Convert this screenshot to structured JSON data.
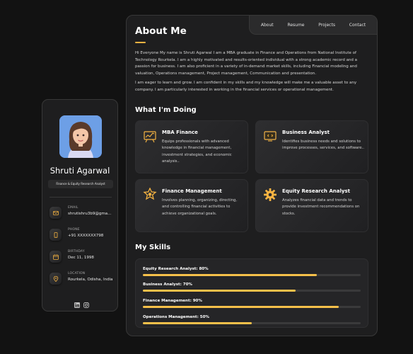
{
  "theme": {
    "accent": "#f5b342",
    "background": "#121212",
    "card": "#1e1e1f"
  },
  "profile": {
    "name": "Shruti Agarwal",
    "title": "Finance & Equity Research Analyst",
    "contacts": [
      {
        "label": "EMAIL",
        "value": "shrutishru3b9@gma...",
        "icon": "mail-icon"
      },
      {
        "label": "PHONE",
        "value": "+91 XXXXXXX798",
        "icon": "phone-icon"
      },
      {
        "label": "BIRTHDAY",
        "value": "Dec 11, 1998",
        "icon": "calendar-icon"
      },
      {
        "label": "LOCATION",
        "value": "Rourkela, Odisha, India",
        "icon": "location-pin-icon"
      }
    ],
    "social": [
      "linkedin-icon",
      "instagram-icon"
    ]
  },
  "nav": {
    "about": "About",
    "resume": "Resume",
    "projects": "Projects",
    "contact": "Contact"
  },
  "about": {
    "heading": "About Me",
    "p1": "Hi Everyone My name is Shruti Agarwal I am a MBA graduate in Finance and Operations from National Institute of Technology Rourkela. I am a highly motivated and results-oriented individual with a strong academic record and a passion for business. I am also proficient in a variety of in-demand market skills, including Financial modeling and valuation, Operations management, Project management, Communication and presentation.",
    "p2": "I am eager to learn and grow. I am confident in my skills and my knowledge will make me a valuable asset to any company. I am particularly interested in working in the financial services or operational management."
  },
  "doing": {
    "heading": "What I'm Doing",
    "services": [
      {
        "title": "MBA Finance",
        "desc": "Equips professionals with advanced knowledge in financial management, investment strategies, and economic analysis..",
        "icon": "chart-board-icon"
      },
      {
        "title": "Business Analyst",
        "desc": "Identifies business needs and solutions to improve processes, services, and software..",
        "icon": "monitor-code-icon"
      },
      {
        "title": "Finance Management",
        "desc": "Involves planning, organizing, directing, and controlling financial activities to achieve organizational goals.",
        "icon": "finance-badge-icon"
      },
      {
        "title": "Equity Research Analyst",
        "desc": "Analyzes financial data and trends to provide investment recommendations on stocks.",
        "icon": "gear-icon"
      }
    ]
  },
  "skills": {
    "heading": "My Skills",
    "items": [
      {
        "label": "Equity Research Analyst: 80%",
        "percent": 80
      },
      {
        "label": "Business Analyst: 70%",
        "percent": 70
      },
      {
        "label": "Finance Management: 90%",
        "percent": 90
      },
      {
        "label": "Operations Management: 50%",
        "percent": 50
      }
    ]
  }
}
